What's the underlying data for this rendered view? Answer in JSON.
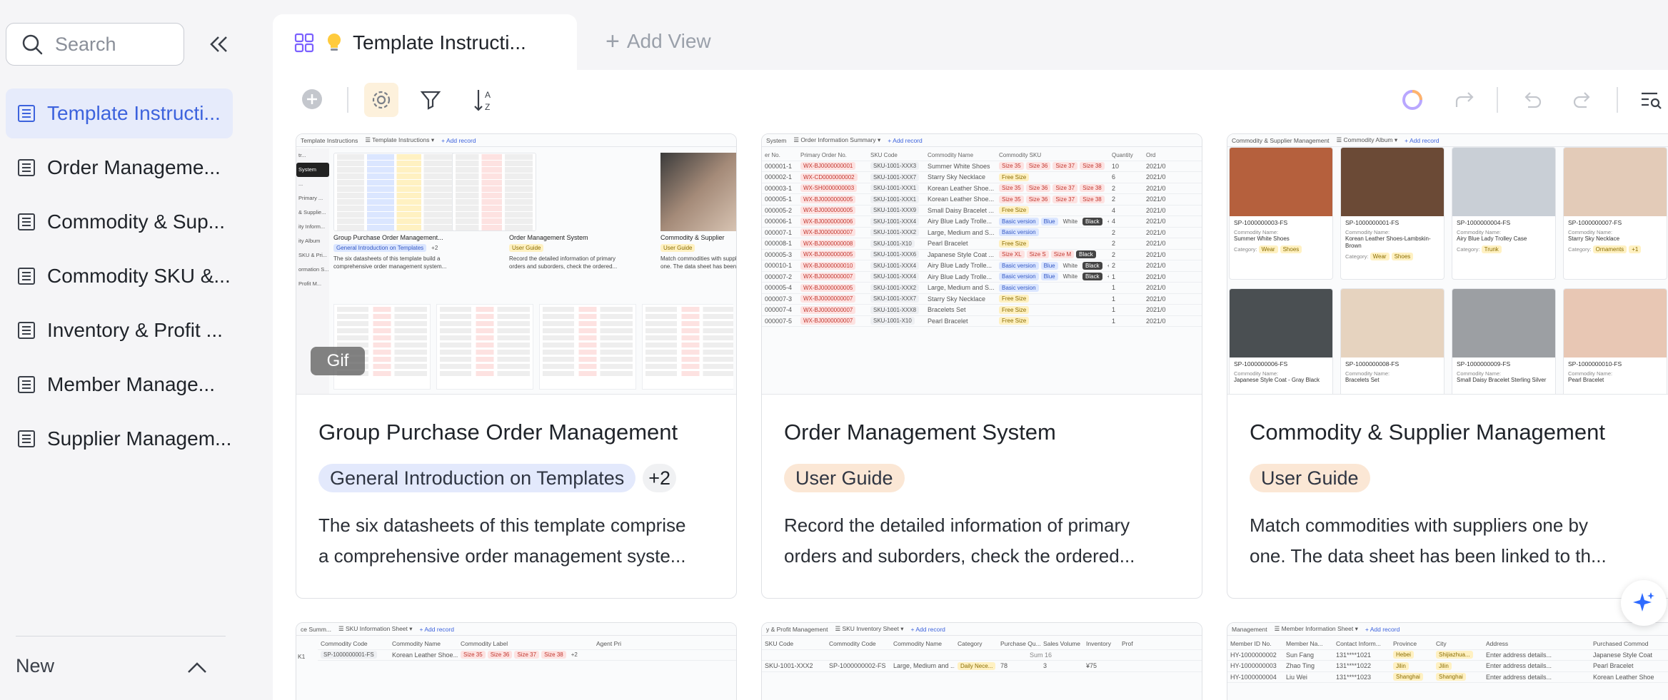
{
  "sidebar": {
    "search_placeholder": "Search",
    "items": [
      {
        "label": "Template Instructi...",
        "active": true
      },
      {
        "label": "Order Manageme..."
      },
      {
        "label": "Commodity & Sup..."
      },
      {
        "label": "Commodity SKU &..."
      },
      {
        "label": "Inventory & Profit ..."
      },
      {
        "label": "Member Manage..."
      },
      {
        "label": "Supplier Managem..."
      }
    ],
    "section_label": "New"
  },
  "tabs": {
    "active_title": "Template Instructi...",
    "add_view_label": "Add View"
  },
  "toolbar_icons": [
    "add-icon",
    "settings-icon",
    "filter-icon",
    "sort-icon",
    "ai-ring-icon",
    "share-icon",
    "undo-icon",
    "redo-icon",
    "search-view-icon"
  ],
  "cards": [
    {
      "title": "Group Purchase Order Management",
      "tags": [
        "General Introduction on Templates"
      ],
      "more_tags": "+2",
      "desc_lines": [
        "The six datasheets of this template comprise",
        "a comprehensive order management syste..."
      ],
      "gif_badge": "Gif"
    },
    {
      "title": "Order Management System",
      "tags": [
        "User Guide"
      ],
      "desc_lines": [
        "Record the detailed information of primary",
        "orders and suborders, check the ordered..."
      ]
    },
    {
      "title": "Commodity & Supplier Management",
      "tags": [
        "User Guide"
      ],
      "desc_lines": [
        "Match commodities with suppliers one by",
        "one. The data sheet has been linked to th..."
      ]
    }
  ],
  "thumb1": {
    "toolbar_text": "Template Instructions",
    "view_text": "Template Instructions",
    "add_record": "+ Add record",
    "nav": [
      "tr...",
      "System",
      "...",
      "Primary ...",
      "& Supplie...",
      "ity Inform...",
      "ity Album",
      "SKU & Pri...",
      "ormation S...",
      "Profit M..."
    ],
    "inner_cards": [
      {
        "title": "Group Purchase Order Management...",
        "tag": "General Introduction on Templates",
        "more": "+2",
        "desc": [
          "The six datasheets of this template build a",
          "comprehensive order management system..."
        ]
      },
      {
        "title": "Order Management System",
        "tag": "User Guide",
        "desc": [
          "Record the detailed information of primary",
          "orders and suborders, check the ordered..."
        ]
      },
      {
        "title": "Commodity & Supplier",
        "tag": "User Guide",
        "desc": [
          "Match commodities with suppliers one by",
          "one. The data sheet has been b..."
        ]
      }
    ]
  },
  "thumb2": {
    "tab_left": "System",
    "view": "Order Information Summary",
    "add_record": "+ Add record",
    "headers": [
      "er No.",
      "Primary Order No.",
      "SKU Code",
      "Commodity Name",
      "Commodity SKU",
      "Quantity",
      "Ord"
    ],
    "rows": [
      [
        "000001-1",
        "WX-BJ0000000001",
        "SKU-1001-XXX3",
        "Summer White Shoes",
        "Size 35|Size 36|Size 37|Size 38|+2",
        "10",
        "2021/0"
      ],
      [
        "000002-1",
        "WX-CD0000000002",
        "SKU-1001-XXX7",
        "Starry Sky Necklace",
        "Free Size",
        "6",
        "2021/0"
      ],
      [
        "000003-1",
        "WX-SH0000000003",
        "SKU-1001-XXX1",
        "Korean Leather Shoe...",
        "Size 35|Size 36|Size 37|Size 38|+2",
        "2",
        "2021/0"
      ],
      [
        "000005-1",
        "WX-BJ0000000005",
        "SKU-1001-XXX1",
        "Korean Leather Shoe...",
        "Size 35|Size 36|Size 37|Size 38|+2",
        "2",
        "2021/0"
      ],
      [
        "000005-2",
        "WX-BJ0000000005",
        "SKU-1001-XXX9",
        "Small Daisy Bracelet ...",
        "Free Size",
        "4",
        "2021/0"
      ],
      [
        "000006-1",
        "WX-BJ0000000006",
        "SKU-1001-XXX4",
        "Airy Blue Lady Trolle...",
        "Basic version|Blue|White|Black|+2",
        "4",
        "2021/0"
      ],
      [
        "000007-1",
        "WX-BJ0000000007",
        "SKU-1001-XXX2",
        "Large, Medium and S...",
        "Basic version",
        "2",
        "2021/0"
      ],
      [
        "000008-1",
        "WX-BJ0000000008",
        "SKU-1001-X10",
        "Pearl Bracelet",
        "Free Size",
        "2",
        "2021/0"
      ],
      [
        "000005-3",
        "WX-BJ0000000005",
        "SKU-1001-XXX6",
        "Japanese Style Coat ...",
        "Size XL|Size S|Size M|Black",
        "2",
        "2021/0"
      ],
      [
        "000010-1",
        "WX-BJ0000000010",
        "SKU-1001-XXX4",
        "Airy Blue Lady Trolle...",
        "Basic version|Blue|White|Black|+2",
        "2",
        "2021/0"
      ],
      [
        "000007-2",
        "WX-BJ0000000007",
        "SKU-1001-XXX4",
        "Airy Blue Lady Trolle...",
        "Basic version|Blue|White|Black|+2",
        "1",
        "2021/0"
      ],
      [
        "000005-4",
        "WX-BJ0000000005",
        "SKU-1001-XXX2",
        "Large, Medium and S...",
        "Basic version",
        "1",
        "2021/0"
      ],
      [
        "000007-3",
        "WX-BJ0000000007",
        "SKU-1001-XXX7",
        "Starry Sky Necklace",
        "Free Size",
        "1",
        "2021/0"
      ],
      [
        "000007-4",
        "WX-BJ0000000007",
        "SKU-1001-XXX8",
        "Bracelets Set",
        "Free Size",
        "1",
        "2021/0"
      ],
      [
        "000007-5",
        "WX-BJ0000000007",
        "SKU-1001-X10",
        "Pearl Bracelet",
        "Free Size",
        "1",
        "2021/0"
      ]
    ]
  },
  "thumb3": {
    "tab_left": "Commodity & Supplier Management",
    "view": "Commodity Album",
    "add_record": "+ Add record",
    "label_name": "Commodity Name:",
    "label_cat": "Category:",
    "items": [
      {
        "id": "SP-1000000003-FS",
        "name": "Summer White Shoes",
        "cats": [
          "Wear",
          "Shoes"
        ],
        "color": "#b5603d"
      },
      {
        "id": "SP-1000000001-FS",
        "name": "Korean Leather Shoes-Lambskin-Brown",
        "cats": [
          "Wear",
          "Shoes"
        ],
        "color": "#6b4a36"
      },
      {
        "id": "SP-1000000004-FS",
        "name": "Airy Blue Lady Trolley Case",
        "cats": [
          "Trunk"
        ],
        "color": "#c9cfd6"
      },
      {
        "id": "SP-1000000007-FS",
        "name": "Starry Sky Necklace",
        "cats": [
          "Ornaments",
          "+1"
        ],
        "color": "#e3cbb8"
      },
      {
        "id": "SP-1000000006-FS",
        "name": "Japanese Style Coat - Gray Black",
        "cats": [],
        "color": "#4a4f52"
      },
      {
        "id": "SP-1000000008-FS",
        "name": "Bracelets Set",
        "cats": [],
        "color": "#e6d3bf"
      },
      {
        "id": "SP-1000000009-FS",
        "name": "Small Daisy Bracelet Sterling Silver",
        "cats": [],
        "color": "#9c9fa3"
      },
      {
        "id": "SP-1000000010-FS",
        "name": "Pearl Bracelet",
        "cats": [],
        "color": "#e8c7b4"
      }
    ]
  },
  "row2": [
    {
      "tab": "ce Summ...",
      "view": "SKU Information Sheet",
      "add_record": "+ Add record",
      "headers": [
        "Commodity Code",
        "Commodity Name",
        "Commodity Label",
        "Agent Pri"
      ],
      "r1": [
        "K1",
        "SP-1000000001-FS",
        "Korean Leather Shoe...",
        "Size 35|Size 36|Size 37|Size 38|+2"
      ]
    },
    {
      "tab": "y & Profit Management",
      "view": "SKU Inventory Sheet",
      "add_record": "+ Add record",
      "headers": [
        "SKU Code",
        "Commodity Code",
        "Commodity Name",
        "Category",
        "Purchase Qu...",
        "Sales Volume",
        "Inventory",
        "Prof"
      ],
      "sum": "Sum 16",
      "r1": [
        "SKU-1001-XXX2",
        "SP-1000000002-FS",
        "Large, Medium and ...",
        "Daily Nece...",
        "78",
        "3",
        "¥75"
      ]
    },
    {
      "tab": "Management",
      "view": "Member Information Sheet",
      "add_record": "+ Add record",
      "headers": [
        "Member ID No.",
        "Member Na...",
        "Contact Inform...",
        "Province",
        "City",
        "Address",
        "Purchased Commod"
      ],
      "rows": [
        [
          "HY-1000000002",
          "Sun Fang",
          "131****1021",
          "Hebei",
          "Shijiazhua...",
          "Enter address details...",
          "Japanese Style Coat"
        ],
        [
          "HY-1000000003",
          "Zhao Ting",
          "131****1022",
          "Jilin",
          "Jilin",
          "Enter address details...",
          "Pearl Bracelet"
        ],
        [
          "HY-1000000004",
          "Liu Wei",
          "131****1023",
          "Shanghai",
          "Shanghai",
          "Enter address details...",
          "Korean Leather Shoe"
        ]
      ]
    }
  ],
  "colors": {
    "accent": "#3d63dd",
    "active_bg": "#e6ebfb",
    "user_guide_tag": "#fbe7d5",
    "intro_tag": "#e3e9fc"
  }
}
